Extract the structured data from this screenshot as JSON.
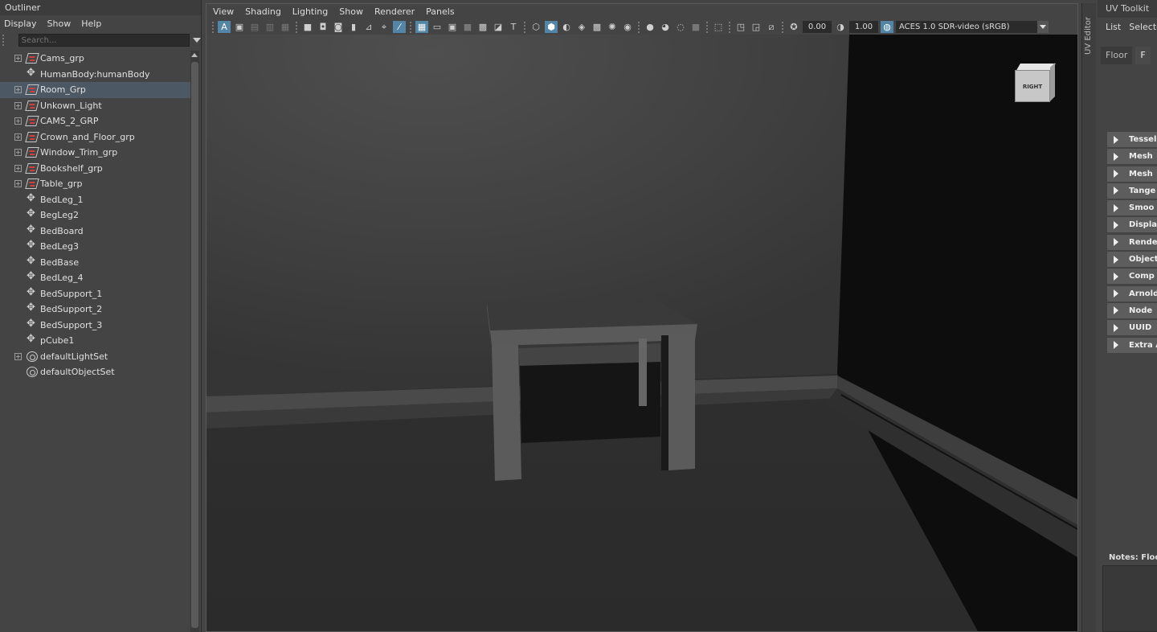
{
  "outliner": {
    "title": "Outliner",
    "menu": [
      "Display",
      "Show",
      "Help"
    ],
    "search_placeholder": "Search...",
    "items": [
      {
        "label": "Cams_grp",
        "type": "group",
        "expandable": true,
        "selected": false
      },
      {
        "label": "HumanBody:humanBody",
        "type": "mesh",
        "expandable": false,
        "selected": false
      },
      {
        "label": "Room_Grp",
        "type": "group",
        "expandable": true,
        "selected": true
      },
      {
        "label": "Unkown_Light",
        "type": "group",
        "expandable": true,
        "selected": false
      },
      {
        "label": "CAMS_2_GRP",
        "type": "group",
        "expandable": true,
        "selected": false
      },
      {
        "label": "Crown_and_Floor_grp",
        "type": "group",
        "expandable": true,
        "selected": false
      },
      {
        "label": "Window_Trim_grp",
        "type": "group",
        "expandable": true,
        "selected": false
      },
      {
        "label": "Bookshelf_grp",
        "type": "group",
        "expandable": true,
        "selected": false
      },
      {
        "label": "Table_grp",
        "type": "group",
        "expandable": true,
        "selected": false
      },
      {
        "label": "BedLeg_1",
        "type": "mesh",
        "expandable": false,
        "selected": false
      },
      {
        "label": "BegLeg2",
        "type": "mesh",
        "expandable": false,
        "selected": false
      },
      {
        "label": "BedBoard",
        "type": "mesh",
        "expandable": false,
        "selected": false
      },
      {
        "label": "BedLeg3",
        "type": "mesh",
        "expandable": false,
        "selected": false
      },
      {
        "label": "BedBase",
        "type": "mesh",
        "expandable": false,
        "selected": false
      },
      {
        "label": "BedLeg_4",
        "type": "mesh",
        "expandable": false,
        "selected": false
      },
      {
        "label": "BedSupport_1",
        "type": "mesh",
        "expandable": false,
        "selected": false
      },
      {
        "label": "BedSupport_2",
        "type": "mesh",
        "expandable": false,
        "selected": false
      },
      {
        "label": "BedSupport_3",
        "type": "mesh",
        "expandable": false,
        "selected": false
      },
      {
        "label": "pCube1",
        "type": "mesh",
        "expandable": false,
        "selected": false
      },
      {
        "label": "defaultLightSet",
        "type": "set",
        "expandable": true,
        "selected": false
      },
      {
        "label": "defaultObjectSet",
        "type": "set",
        "expandable": false,
        "selected": false
      }
    ]
  },
  "viewport": {
    "menu": [
      "View",
      "Shading",
      "Lighting",
      "Show",
      "Renderer",
      "Panels"
    ],
    "exposure_value": "0.00",
    "gamma_value": "1.00",
    "color_space": "ACES 1.0 SDR-video (sRGB)",
    "view_cube_label": "RIGHT"
  },
  "uv_editor_tab": "UV Editor",
  "right_panel": {
    "title": "UV Toolkit",
    "menu": [
      "List",
      "Selecte"
    ],
    "tabs": [
      "Floor",
      "F"
    ],
    "sections": [
      "Tessell",
      "Mesh",
      "Mesh",
      "Tange",
      "Smoo",
      "Displa",
      "Rende",
      "Object",
      "Comp",
      "Arnold",
      "Node",
      "UUID",
      "Extra A"
    ],
    "notes_label": "Notes: Floo"
  },
  "colors": {
    "selection_highlight": "#4c5863",
    "toolbar_active": "#5285a6",
    "panel_bg": "#444444"
  }
}
